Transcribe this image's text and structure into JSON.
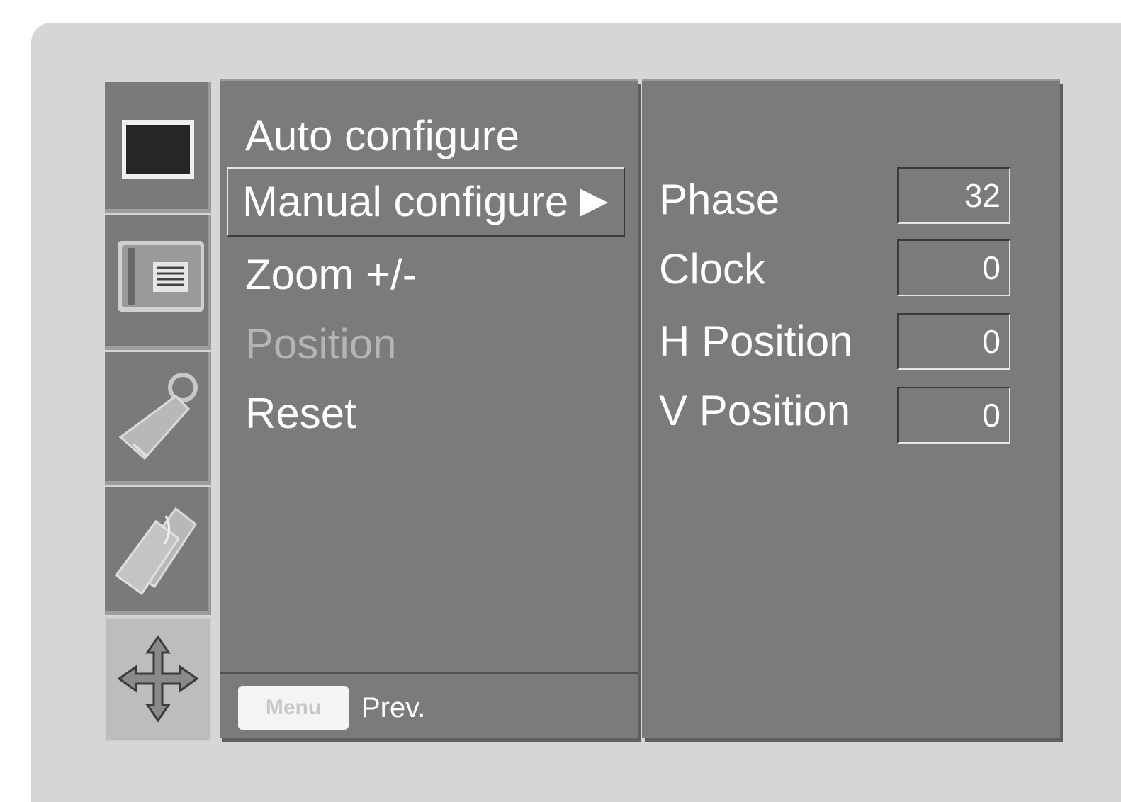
{
  "sidebar": {
    "icons": [
      {
        "name": "picture-icon"
      },
      {
        "name": "screen-icon"
      },
      {
        "name": "setup-icon"
      },
      {
        "name": "special-icon"
      },
      {
        "name": "position-move-icon"
      }
    ]
  },
  "menu": {
    "items": [
      {
        "label": "Auto configure",
        "state": "normal"
      },
      {
        "label": "Manual configure",
        "state": "selected"
      },
      {
        "label": "Zoom +/-",
        "state": "normal"
      },
      {
        "label": "Position",
        "state": "disabled"
      },
      {
        "label": "Reset",
        "state": "normal"
      }
    ],
    "footer": {
      "key_label": "Menu",
      "prev_label": "Prev."
    }
  },
  "settings": {
    "rows": [
      {
        "label": "Phase",
        "value": "32"
      },
      {
        "label": "Clock",
        "value": "0"
      },
      {
        "label": "H Position",
        "value": "0"
      },
      {
        "label": "V Position",
        "value": "0"
      }
    ]
  },
  "colors": {
    "panel": "#7b7b7b",
    "frame": "#d6d6d6",
    "text": "#ffffff",
    "disabled_text": "#b4b4b4"
  }
}
